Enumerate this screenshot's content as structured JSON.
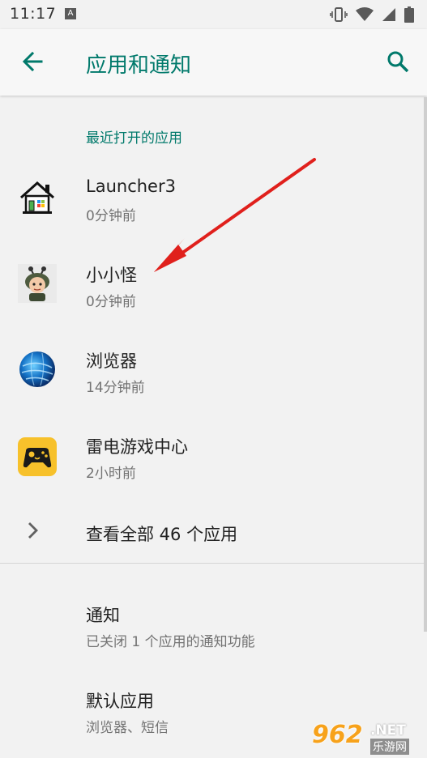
{
  "status_bar": {
    "time": "11:17",
    "notification_badge": "A"
  },
  "header": {
    "title": "应用和通知",
    "back_icon": "arrow-back-icon",
    "search_icon": "search-icon"
  },
  "recent_section": {
    "title": "最近打开的应用",
    "apps": [
      {
        "name": "Launcher3",
        "time": "0分钟前",
        "icon": "launcher-house-icon"
      },
      {
        "name": "小小怪",
        "time": "0分钟前",
        "icon": "xiaoxiaoguai-icon"
      },
      {
        "name": "浏览器",
        "time": "14分钟前",
        "icon": "browser-globe-icon"
      },
      {
        "name": "雷电游戏中心",
        "time": "2小时前",
        "icon": "gamepad-icon"
      }
    ],
    "see_all": "查看全部 46 个应用"
  },
  "preferences": [
    {
      "title": "通知",
      "summary": "已关闭 1 个应用的通知功能"
    },
    {
      "title": "默认应用",
      "summary": "浏览器、短信"
    }
  ],
  "watermark": {
    "number": "962",
    "domain": ".NET",
    "label": "乐游网"
  },
  "colors": {
    "accent": "#00796b",
    "annotation_arrow": "#e0201c"
  }
}
